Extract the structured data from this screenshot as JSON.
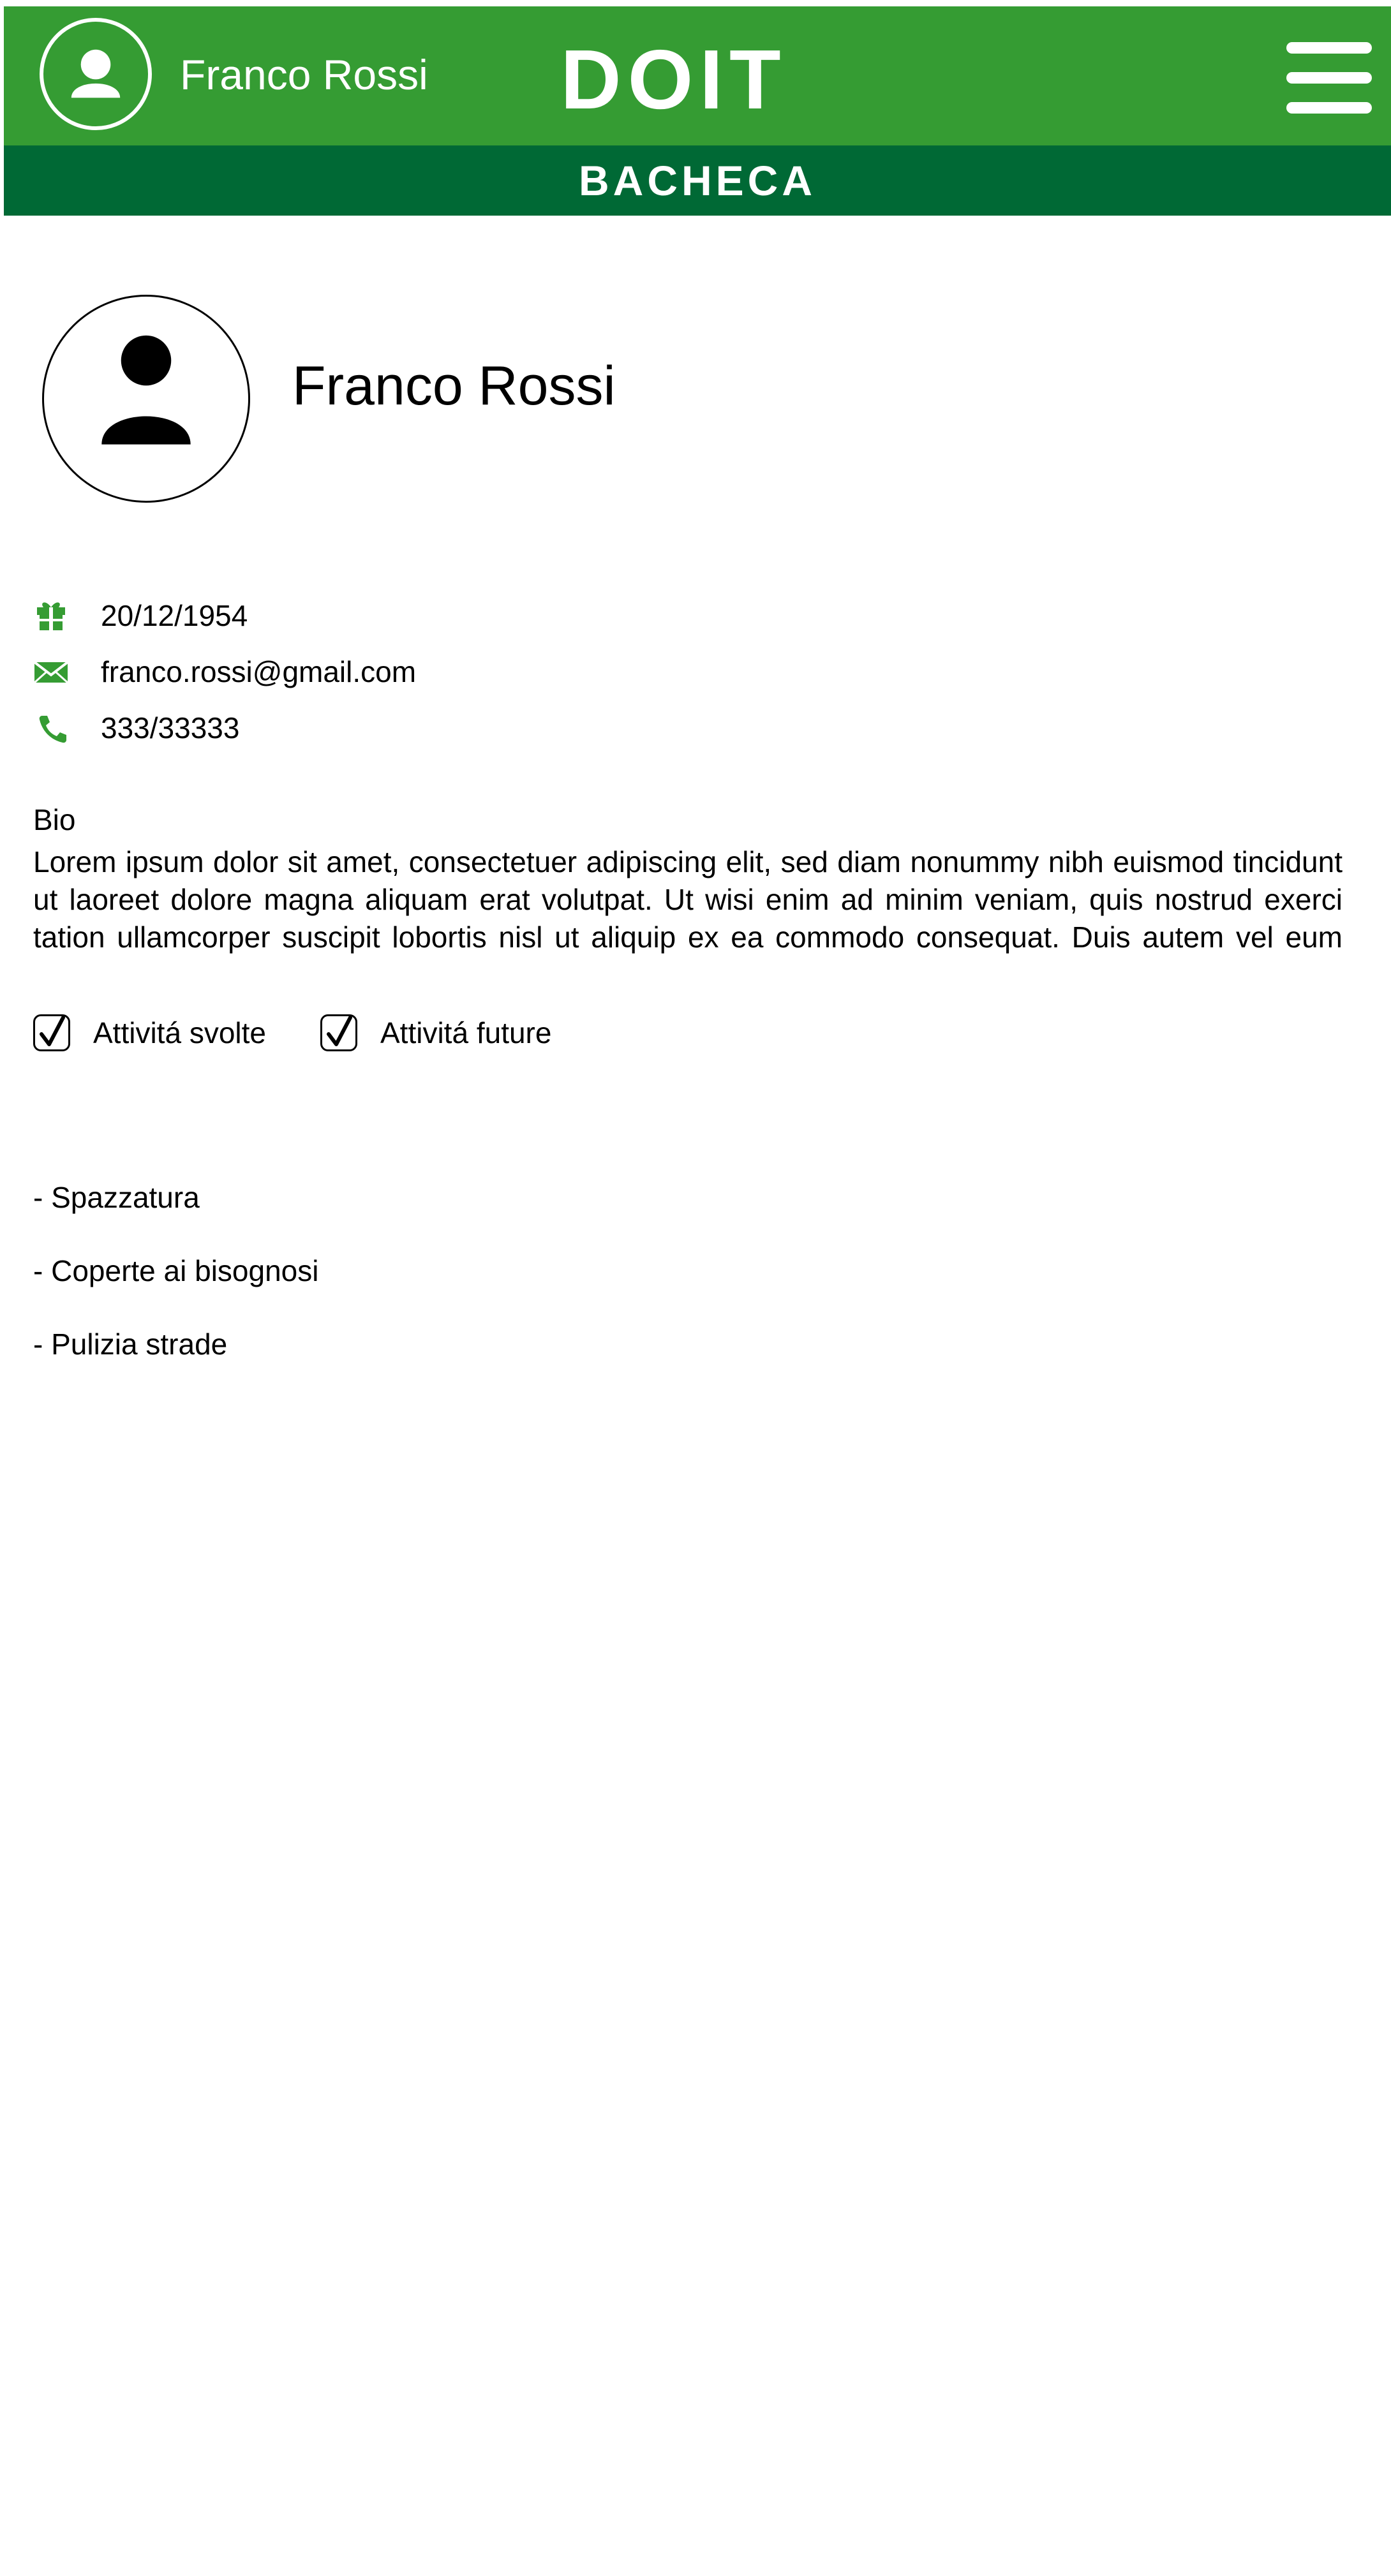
{
  "header": {
    "username": "Franco Rossi",
    "logo": "DOIT",
    "avatar_icon": "user-icon",
    "menu_icon": "hamburger-menu-icon",
    "background_color": "#359c33"
  },
  "subheader": {
    "title": "BACHECA",
    "background_color": "#006935"
  },
  "profile": {
    "name": "Franco Rossi",
    "avatar_icon": "user-icon",
    "info": [
      {
        "icon": "gift-icon",
        "text": "20/12/1954"
      },
      {
        "icon": "mail-icon",
        "text": "franco.rossi@gmail.com"
      },
      {
        "icon": "phone-icon",
        "text": "333/33333"
      }
    ],
    "icon_color": "#359c33",
    "bio_label": "Bio",
    "bio_text": "Lorem ipsum dolor sit amet, consectetuer adipiscing elit, sed diam nonummy nibh euismod tincidunt ut laoreet dolore magna aliquam erat volutpat. Ut wisi enim ad minim veniam, quis nostrud exerci tation ullamcorper suscipit lobortis nisl ut aliquip ex ea commodo consequat. Duis autem vel eum iriure dolor in"
  },
  "filters": [
    {
      "label": "Attivitá svolte",
      "checked": true
    },
    {
      "label": "Attivitá future",
      "checked": true
    }
  ],
  "activities": [
    "- Spazzatura",
    "- Coperte ai bisognosi",
    "- Pulizia strade"
  ]
}
